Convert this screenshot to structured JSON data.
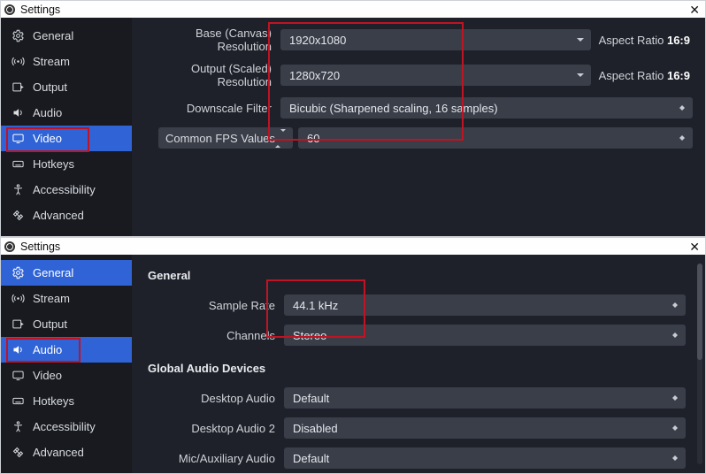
{
  "windows": [
    {
      "title": "Settings",
      "selectedNav": "Video",
      "highlightNav": [
        "Video"
      ],
      "nav": [
        "General",
        "Stream",
        "Output",
        "Audio",
        "Video",
        "Hotkeys",
        "Accessibility",
        "Advanced"
      ],
      "fields": {
        "baseLabel": "Base (Canvas) Resolution",
        "baseValue": "1920x1080",
        "baseAspect": "Aspect Ratio ",
        "baseAspectRatio": "16:9",
        "outputLabel": "Output (Scaled) Resolution",
        "outputValue": "1280x720",
        "outputAspect": "Aspect Ratio ",
        "outputAspectRatio": "16:9",
        "downscaleLabel": "Downscale Filter",
        "downscaleValue": "Bicubic (Sharpened scaling, 16 samples)",
        "fpsLabel": "Common FPS Values",
        "fpsValue": "60"
      }
    },
    {
      "title": "Settings",
      "selectedNav": "General",
      "alsoSelected": "Audio",
      "highlightNav": [
        "Audio"
      ],
      "nav": [
        "General",
        "Stream",
        "Output",
        "Audio",
        "Video",
        "Hotkeys",
        "Accessibility",
        "Advanced"
      ],
      "sections": {
        "generalHdr": "General",
        "sampleLabel": "Sample Rate",
        "sampleValue": "44.1 kHz",
        "channelsLabel": "Channels",
        "channelsValue": "Stereo",
        "devicesHdr": "Global Audio Devices",
        "desktopLabel": "Desktop Audio",
        "desktopValue": "Default",
        "desktop2Label": "Desktop Audio 2",
        "desktop2Value": "Disabled",
        "micLabel": "Mic/Auxiliary Audio",
        "micValue": "Default"
      }
    }
  ]
}
